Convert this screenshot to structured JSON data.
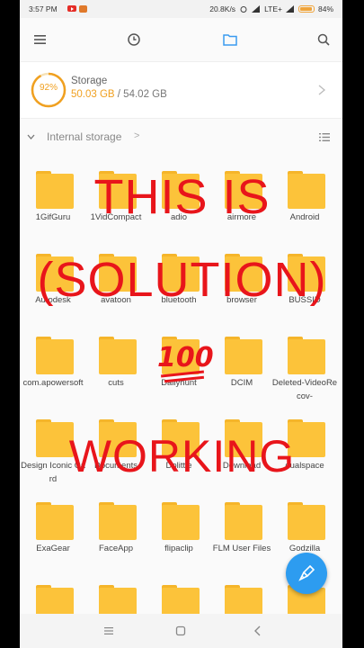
{
  "status_bar": {
    "time": "3:57 PM",
    "speed": "20.8K/s",
    "network": "LTE+",
    "battery": "84%"
  },
  "storage": {
    "percent_label": "92%",
    "percent_value": 92,
    "title": "Storage",
    "used": "50.03 GB",
    "total": "/ 54.02 GB"
  },
  "breadcrumb": {
    "label": "Internal storage",
    "arrow": ">"
  },
  "folders": [
    "1GifGuru",
    "1VidCompact",
    "adio",
    "airmore",
    "Android",
    "Autodesk",
    "avatoon",
    "bluetooth",
    "browser",
    "BUSSID",
    "com.apowersoft",
    "cuts",
    "Dailyhunt",
    "DCIM",
    "Deleted-VideoRecov-",
    "Design Iconic Card",
    "Documents",
    "Dolittle",
    "Download",
    "dualspace",
    "ExaGear",
    "FaceApp",
    "flipaclip",
    "FLM User Files",
    "Godzilla"
  ],
  "overlay": {
    "line1": "THIS IS",
    "line2": "(SOLUTION)",
    "line3": "WORKING",
    "emoji": "100"
  },
  "colors": {
    "folder": "#fcc33a",
    "accent": "#f0a020",
    "overlay": "#e8151b",
    "fab": "#2d9cf0"
  },
  "icons": {
    "menu": "hamburger-menu-icon",
    "recent": "clock-icon",
    "folder_tab": "folder-icon",
    "search": "search-icon",
    "fab": "broom-clean-icon"
  }
}
